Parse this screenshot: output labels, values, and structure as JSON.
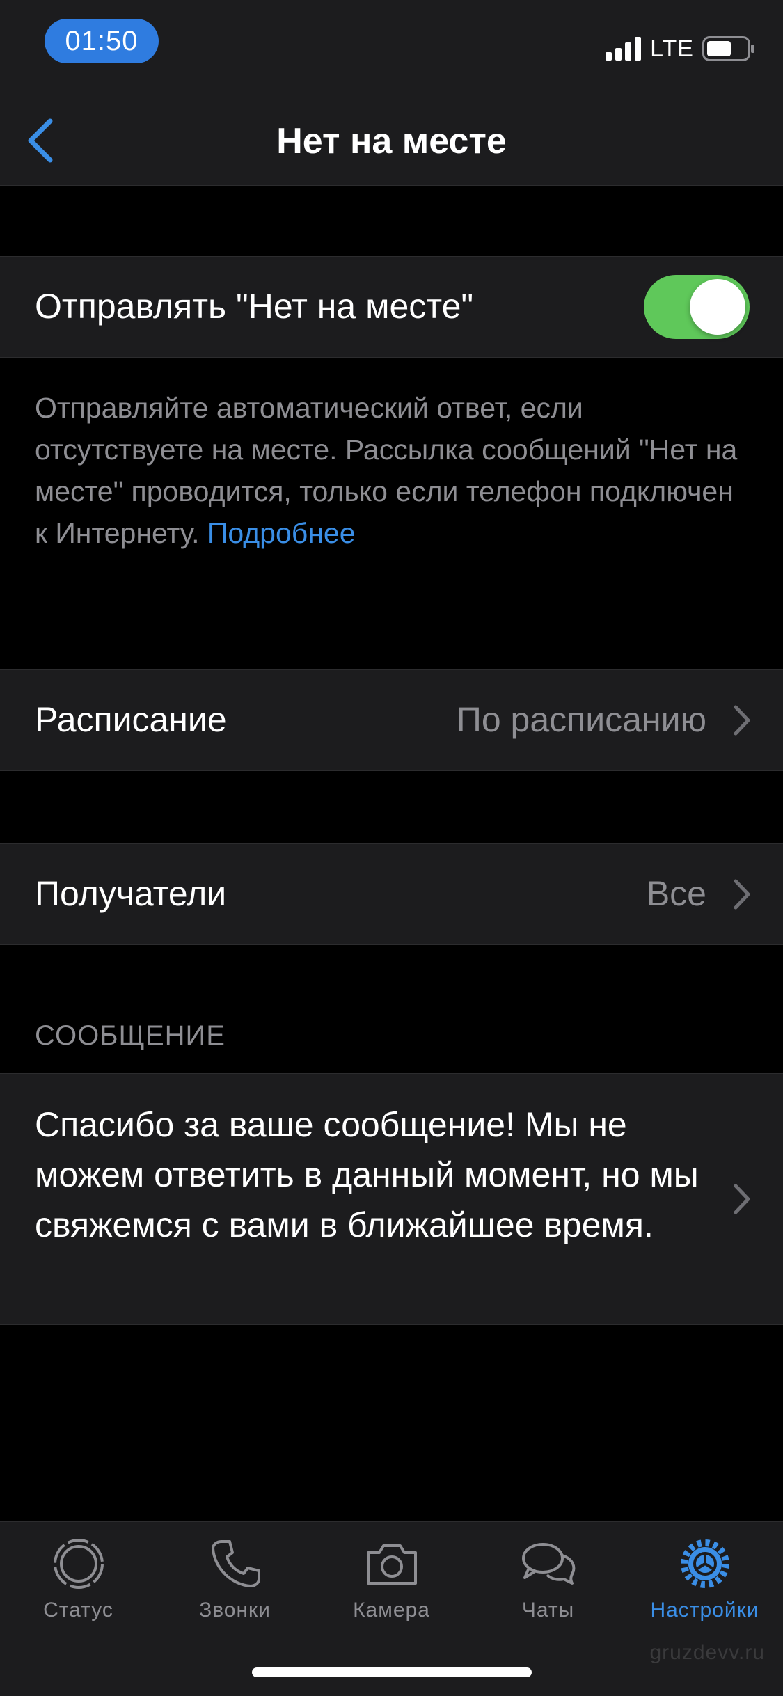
{
  "status_bar": {
    "time": "01:50",
    "network": "LTE",
    "accent_color": "#2f7ce0"
  },
  "nav": {
    "title": "Нет на месте",
    "back_icon": "chevron-left-icon"
  },
  "away_toggle": {
    "label": "Отправлять \"Нет на месте\"",
    "enabled": true,
    "on_color": "#5fc85a"
  },
  "footnote": {
    "text": "Отправляйте автоматический ответ, если отсутствуете на месте. Рассылка сообщений \"Нет на месте\" проводится, только если телефон подключен к Интернету.",
    "link_text": "Подробнее",
    "link_color": "#3a8ee6"
  },
  "schedule": {
    "label": "Расписание",
    "value": "По расписанию"
  },
  "recipients": {
    "label": "Получатели",
    "value": "Все"
  },
  "message_section": {
    "header": "СООБЩЕНИЕ",
    "text": "Спасибо за ваше сообщение! Мы не можем ответить в данный момент, но мы свяжемся с вами в ближайшее время."
  },
  "tab_bar": {
    "tabs": [
      {
        "label": "Статус",
        "icon": "status-icon",
        "active": false
      },
      {
        "label": "Звонки",
        "icon": "phone-icon",
        "active": false
      },
      {
        "label": "Камера",
        "icon": "camera-icon",
        "active": false
      },
      {
        "label": "Чаты",
        "icon": "chats-icon",
        "active": false
      },
      {
        "label": "Настройки",
        "icon": "settings-gear-icon",
        "active": true
      }
    ],
    "active_color": "#3a8ee6"
  },
  "watermark": "gruzdevv.ru"
}
